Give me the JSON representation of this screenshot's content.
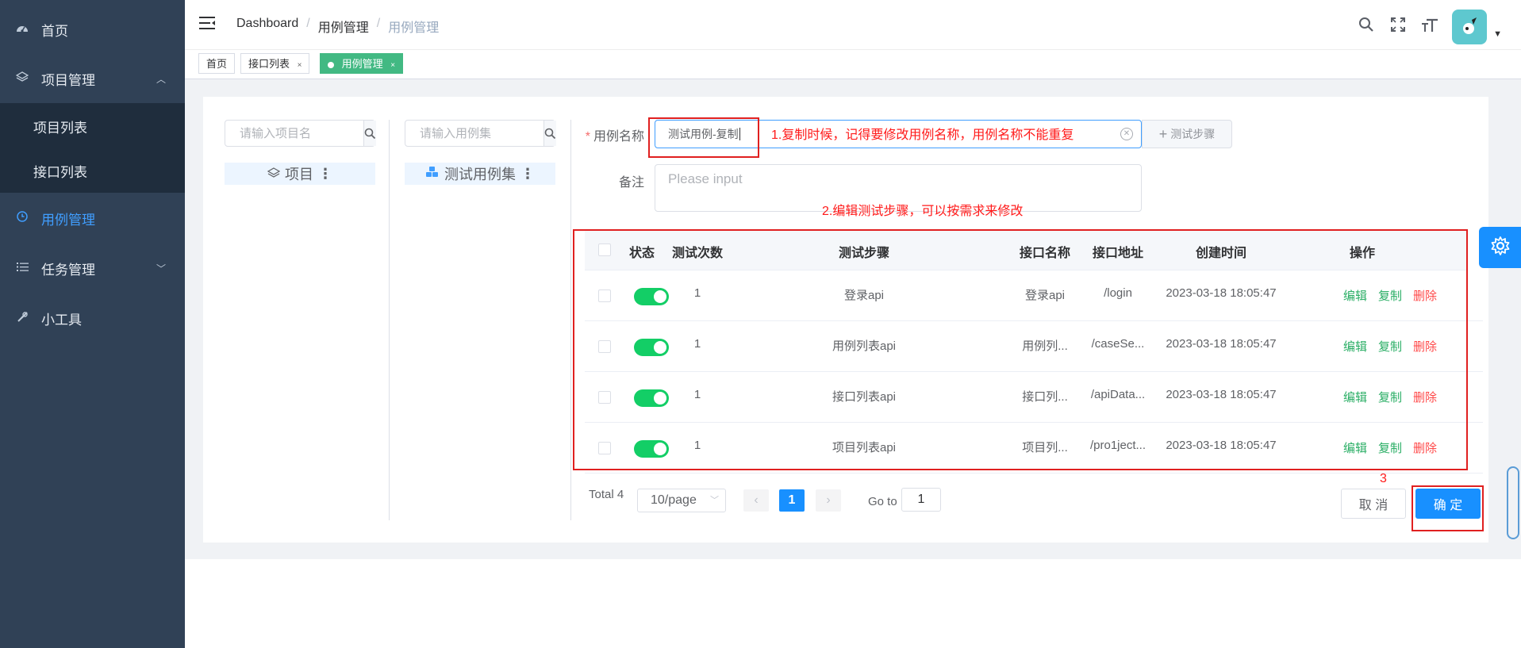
{
  "sidebar": {
    "items": [
      {
        "label": "首页",
        "icon": "dashboard-icon"
      },
      {
        "label": "项目管理",
        "icon": "layers-icon"
      },
      {
        "label": "项目列表"
      },
      {
        "label": "接口列表"
      },
      {
        "label": "用例管理",
        "icon": "clock-icon"
      },
      {
        "label": "任务管理",
        "icon": "list-icon"
      },
      {
        "label": "小工具",
        "icon": "tools-icon"
      }
    ]
  },
  "navbar": {
    "breadcrumb": [
      "Dashboard",
      "用例管理",
      "用例管理"
    ],
    "sep": "/"
  },
  "tags": [
    {
      "label": "首页"
    },
    {
      "label": "接口列表",
      "close": "×"
    },
    {
      "label": "用例管理",
      "close": "×"
    }
  ],
  "left_panel": {
    "project_search_placeholder": "请输入项目名",
    "project_node": "项目",
    "case_search_placeholder": "请输入用例集",
    "case_node": "测试用例集"
  },
  "form": {
    "name_label": "用例名称",
    "name_value": "测试用例-复制",
    "step_button": "测试步骤",
    "remark_label": "备注",
    "remark_placeholder": "Please input"
  },
  "annotations": {
    "a1": "1.复制时候，记得要修改用例名称，用例名称不能重复",
    "a2": "2.编辑测试步骤，可以按需求来修改",
    "a3": "3"
  },
  "table": {
    "headers": [
      "状态",
      "测试次数",
      "测试步骤",
      "接口名称",
      "接口地址",
      "创建时间",
      "操作"
    ],
    "rows": [
      {
        "count": "1",
        "step": "登录api",
        "api_name": "登录api",
        "api_path": "/login",
        "created": "2023-03-18 18:05:47",
        "enabled": true
      },
      {
        "count": "1",
        "step": "用例列表api",
        "api_name": "用例列...",
        "api_path": "/caseSe...",
        "created": "2023-03-18 18:05:47",
        "enabled": true
      },
      {
        "count": "1",
        "step": "接口列表api",
        "api_name": "接口列...",
        "api_path": "/apiData...",
        "created": "2023-03-18 18:05:47",
        "enabled": true
      },
      {
        "count": "1",
        "step": "项目列表api",
        "api_name": "项目列...",
        "api_path": "/pro1ject...",
        "created": "2023-03-18 18:05:47",
        "enabled": true
      }
    ],
    "ops": {
      "edit": "编辑",
      "copy": "复制",
      "delete": "删除"
    }
  },
  "pagination": {
    "total": "Total 4",
    "page_size": "10/page",
    "current": "1",
    "goto_label": "Go to",
    "goto_value": "1"
  },
  "buttons": {
    "cancel": "取 消",
    "confirm": "确 定"
  },
  "colors": {
    "sidebar_bg": "#304156",
    "accent": "#1890ff",
    "switch_on": "#13ce66",
    "annotation": "#ff1a1a",
    "tag_active": "#42b983"
  }
}
